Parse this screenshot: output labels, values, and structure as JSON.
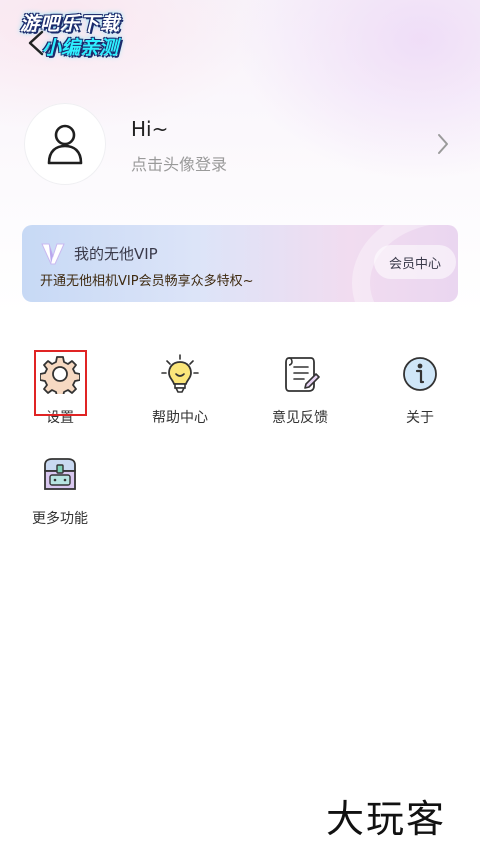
{
  "watermark_top": {
    "line1": "游吧乐下载",
    "line2": "小编亲测"
  },
  "profile": {
    "greeting": "Hi~",
    "subtitle": "点击头像登录"
  },
  "vip": {
    "title": "我的无他VIP",
    "description": "开通无他相机VIP会员畅享众多特权~",
    "button_label": "会员中心"
  },
  "features": [
    {
      "label": "设置",
      "icon": "gear-icon"
    },
    {
      "label": "帮助中心",
      "icon": "lightbulb-icon"
    },
    {
      "label": "意见反馈",
      "icon": "scroll-icon"
    },
    {
      "label": "关于",
      "icon": "info-icon"
    },
    {
      "label": "更多功能",
      "icon": "treasure-chest-icon"
    }
  ],
  "watermark_bottom": "大玩客",
  "colors": {
    "highlight": "#e02424",
    "icon_outline": "#333333",
    "gear_fill": "#f6d9c2",
    "bulb_fill": "#fbe67a"
  }
}
